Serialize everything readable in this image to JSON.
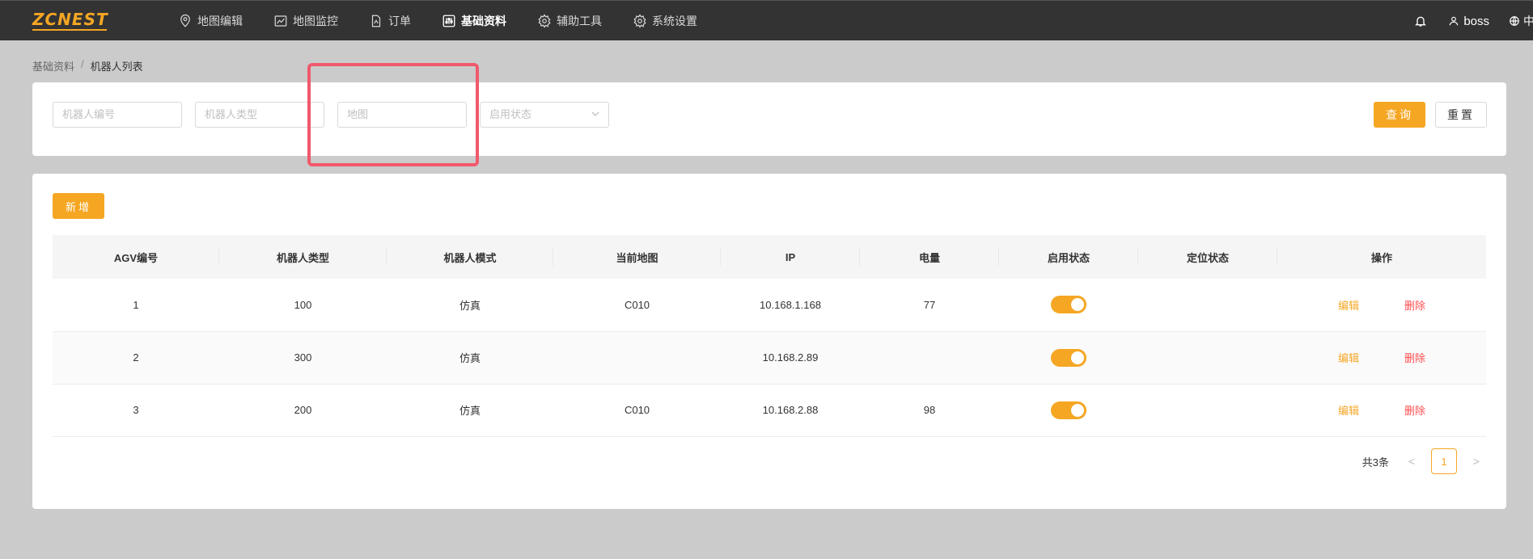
{
  "brand": {
    "logo_text": "ZCNEST"
  },
  "nav": {
    "items": [
      {
        "label": "地图编辑",
        "icon": "map-pin-icon"
      },
      {
        "label": "地图监控",
        "icon": "chart-line-icon"
      },
      {
        "label": "订单",
        "icon": "file-icon"
      },
      {
        "label": "基础资料",
        "icon": "sliders-icon",
        "active": true
      },
      {
        "label": "辅助工具",
        "icon": "gear-icon"
      },
      {
        "label": "系统设置",
        "icon": "gear-icon"
      }
    ],
    "user": "boss",
    "lang": "中文"
  },
  "breadcrumb": {
    "root": "基础资料",
    "separator": "/",
    "current": "机器人列表"
  },
  "filters": {
    "robot_no_placeholder": "机器人编号",
    "robot_type_placeholder": "机器人类型",
    "map_placeholder": "地图",
    "status_placeholder": "启用状态",
    "query_label": "查询",
    "reset_label": "重置"
  },
  "table": {
    "add_label": "新增",
    "columns": [
      "AGV编号",
      "机器人类型",
      "机器人模式",
      "当前地图",
      "IP",
      "电量",
      "启用状态",
      "定位状态",
      "操作"
    ],
    "rows": [
      {
        "agv": "1",
        "type": "100",
        "mode": "仿真",
        "map": "C010",
        "ip": "10.168.1.168",
        "battery": "77",
        "enabled": true,
        "locate": ""
      },
      {
        "agv": "2",
        "type": "300",
        "mode": "仿真",
        "map": "",
        "ip": "10.168.2.89",
        "battery": "",
        "enabled": true,
        "locate": ""
      },
      {
        "agv": "3",
        "type": "200",
        "mode": "仿真",
        "map": "C010",
        "ip": "10.168.2.88",
        "battery": "98",
        "enabled": true,
        "locate": ""
      }
    ],
    "edit_label": "编辑",
    "delete_label": "删除"
  },
  "pagination": {
    "total_text": "共3条",
    "current_page": "1",
    "prev": "<",
    "next": ">"
  },
  "colors": {
    "accent": "#f5a623",
    "danger": "#ff4d4f",
    "topbar": "#333333",
    "highlight": "#f0596b"
  }
}
